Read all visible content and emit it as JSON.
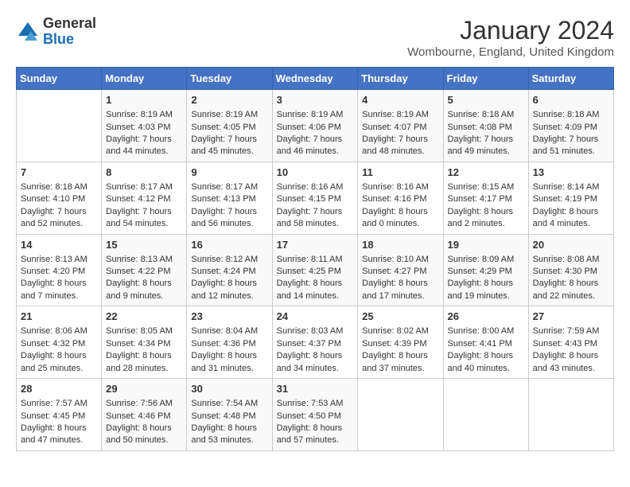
{
  "header": {
    "logo_general": "General",
    "logo_blue": "Blue",
    "month_title": "January 2024",
    "subtitle": "Wombourne, England, United Kingdom"
  },
  "days_of_week": [
    "Sunday",
    "Monday",
    "Tuesday",
    "Wednesday",
    "Thursday",
    "Friday",
    "Saturday"
  ],
  "weeks": [
    [
      {
        "day": "",
        "data": ""
      },
      {
        "day": "1",
        "data": "Sunrise: 8:19 AM\nSunset: 4:03 PM\nDaylight: 7 hours\nand 44 minutes."
      },
      {
        "day": "2",
        "data": "Sunrise: 8:19 AM\nSunset: 4:05 PM\nDaylight: 7 hours\nand 45 minutes."
      },
      {
        "day": "3",
        "data": "Sunrise: 8:19 AM\nSunset: 4:06 PM\nDaylight: 7 hours\nand 46 minutes."
      },
      {
        "day": "4",
        "data": "Sunrise: 8:19 AM\nSunset: 4:07 PM\nDaylight: 7 hours\nand 48 minutes."
      },
      {
        "day": "5",
        "data": "Sunrise: 8:18 AM\nSunset: 4:08 PM\nDaylight: 7 hours\nand 49 minutes."
      },
      {
        "day": "6",
        "data": "Sunrise: 8:18 AM\nSunset: 4:09 PM\nDaylight: 7 hours\nand 51 minutes."
      }
    ],
    [
      {
        "day": "7",
        "data": "Sunrise: 8:18 AM\nSunset: 4:10 PM\nDaylight: 7 hours\nand 52 minutes."
      },
      {
        "day": "8",
        "data": "Sunrise: 8:17 AM\nSunset: 4:12 PM\nDaylight: 7 hours\nand 54 minutes."
      },
      {
        "day": "9",
        "data": "Sunrise: 8:17 AM\nSunset: 4:13 PM\nDaylight: 7 hours\nand 56 minutes."
      },
      {
        "day": "10",
        "data": "Sunrise: 8:16 AM\nSunset: 4:15 PM\nDaylight: 7 hours\nand 58 minutes."
      },
      {
        "day": "11",
        "data": "Sunrise: 8:16 AM\nSunset: 4:16 PM\nDaylight: 8 hours\nand 0 minutes."
      },
      {
        "day": "12",
        "data": "Sunrise: 8:15 AM\nSunset: 4:17 PM\nDaylight: 8 hours\nand 2 minutes."
      },
      {
        "day": "13",
        "data": "Sunrise: 8:14 AM\nSunset: 4:19 PM\nDaylight: 8 hours\nand 4 minutes."
      }
    ],
    [
      {
        "day": "14",
        "data": "Sunrise: 8:13 AM\nSunset: 4:20 PM\nDaylight: 8 hours\nand 7 minutes."
      },
      {
        "day": "15",
        "data": "Sunrise: 8:13 AM\nSunset: 4:22 PM\nDaylight: 8 hours\nand 9 minutes."
      },
      {
        "day": "16",
        "data": "Sunrise: 8:12 AM\nSunset: 4:24 PM\nDaylight: 8 hours\nand 12 minutes."
      },
      {
        "day": "17",
        "data": "Sunrise: 8:11 AM\nSunset: 4:25 PM\nDaylight: 8 hours\nand 14 minutes."
      },
      {
        "day": "18",
        "data": "Sunrise: 8:10 AM\nSunset: 4:27 PM\nDaylight: 8 hours\nand 17 minutes."
      },
      {
        "day": "19",
        "data": "Sunrise: 8:09 AM\nSunset: 4:29 PM\nDaylight: 8 hours\nand 19 minutes."
      },
      {
        "day": "20",
        "data": "Sunrise: 8:08 AM\nSunset: 4:30 PM\nDaylight: 8 hours\nand 22 minutes."
      }
    ],
    [
      {
        "day": "21",
        "data": "Sunrise: 8:06 AM\nSunset: 4:32 PM\nDaylight: 8 hours\nand 25 minutes."
      },
      {
        "day": "22",
        "data": "Sunrise: 8:05 AM\nSunset: 4:34 PM\nDaylight: 8 hours\nand 28 minutes."
      },
      {
        "day": "23",
        "data": "Sunrise: 8:04 AM\nSunset: 4:36 PM\nDaylight: 8 hours\nand 31 minutes."
      },
      {
        "day": "24",
        "data": "Sunrise: 8:03 AM\nSunset: 4:37 PM\nDaylight: 8 hours\nand 34 minutes."
      },
      {
        "day": "25",
        "data": "Sunrise: 8:02 AM\nSunset: 4:39 PM\nDaylight: 8 hours\nand 37 minutes."
      },
      {
        "day": "26",
        "data": "Sunrise: 8:00 AM\nSunset: 4:41 PM\nDaylight: 8 hours\nand 40 minutes."
      },
      {
        "day": "27",
        "data": "Sunrise: 7:59 AM\nSunset: 4:43 PM\nDaylight: 8 hours\nand 43 minutes."
      }
    ],
    [
      {
        "day": "28",
        "data": "Sunrise: 7:57 AM\nSunset: 4:45 PM\nDaylight: 8 hours\nand 47 minutes."
      },
      {
        "day": "29",
        "data": "Sunrise: 7:56 AM\nSunset: 4:46 PM\nDaylight: 8 hours\nand 50 minutes."
      },
      {
        "day": "30",
        "data": "Sunrise: 7:54 AM\nSunset: 4:48 PM\nDaylight: 8 hours\nand 53 minutes."
      },
      {
        "day": "31",
        "data": "Sunrise: 7:53 AM\nSunset: 4:50 PM\nDaylight: 8 hours\nand 57 minutes."
      },
      {
        "day": "",
        "data": ""
      },
      {
        "day": "",
        "data": ""
      },
      {
        "day": "",
        "data": ""
      }
    ]
  ]
}
